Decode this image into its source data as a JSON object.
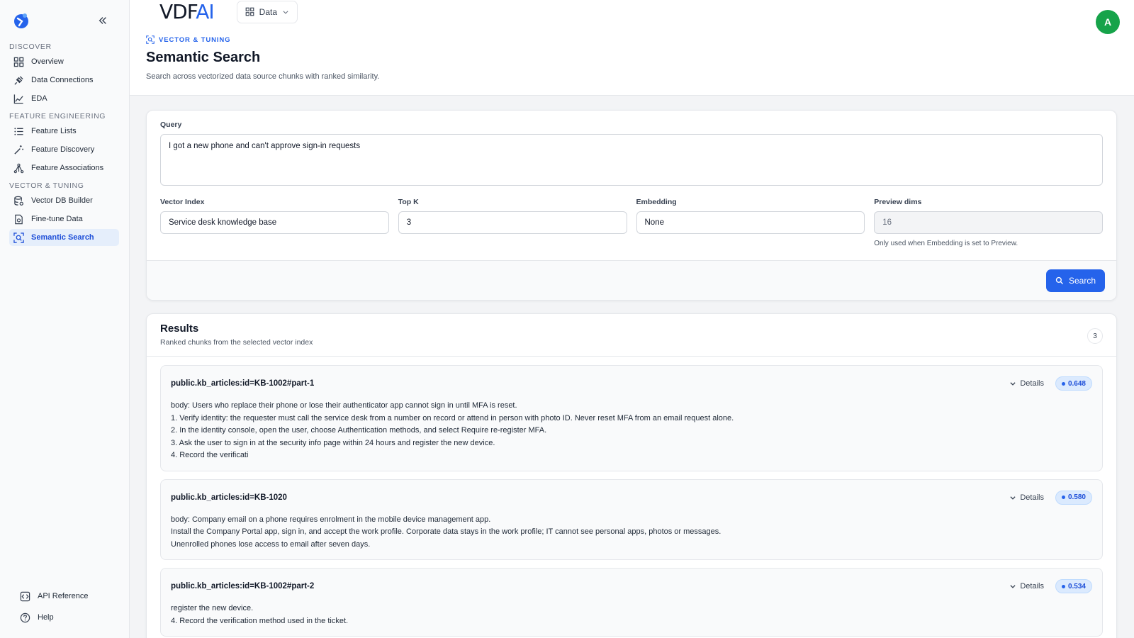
{
  "sidebar": {
    "sections": [
      {
        "title": "DISCOVER",
        "items": [
          {
            "label": "Overview",
            "icon": "grid-icon"
          },
          {
            "label": "Data Connections",
            "icon": "plug-icon"
          },
          {
            "label": "EDA",
            "icon": "chart-icon"
          }
        ]
      },
      {
        "title": "FEATURE ENGINEERING",
        "items": [
          {
            "label": "Feature Lists",
            "icon": "list-icon"
          },
          {
            "label": "Feature Discovery",
            "icon": "wand-icon"
          },
          {
            "label": "Feature Associations",
            "icon": "network-icon"
          }
        ]
      },
      {
        "title": "VECTOR & TUNING",
        "items": [
          {
            "label": "Vector DB Builder",
            "icon": "database-icon"
          },
          {
            "label": "Fine-tune Data",
            "icon": "file-icon"
          },
          {
            "label": "Semantic Search",
            "icon": "search-scan-icon",
            "active": true
          }
        ]
      }
    ],
    "bottom": [
      {
        "label": "API Reference",
        "icon": "code-icon"
      },
      {
        "label": "Help",
        "icon": "help-icon"
      }
    ]
  },
  "topbar": {
    "brand_main": "VDF",
    "brand_accent": "AI",
    "data_select": "Data",
    "avatar": "A"
  },
  "header": {
    "eyebrow": "VECTOR & TUNING",
    "title": "Semantic Search",
    "subtitle": "Search across vectorized data source chunks with ranked similarity."
  },
  "query": {
    "label": "Query",
    "value": "I got a new phone and can't approve sign-in requests",
    "fields": [
      {
        "label": "Vector Index",
        "value": "Service desk knowledge base"
      },
      {
        "label": "Top K",
        "value": "3"
      },
      {
        "label": "Embedding",
        "value": "None"
      },
      {
        "label": "Preview dims",
        "value": "16",
        "help": "Only used when Embedding is set to Preview."
      }
    ],
    "search_label": "Search"
  },
  "results": {
    "title": "Results",
    "subtitle": "Ranked chunks from the selected vector index",
    "count": "3",
    "details_label": "Details",
    "items": [
      {
        "id": "public.kb_articles:id=KB-1002#part-1",
        "score": "0.648",
        "lines": [
          "body: Users who replace their phone or lose their authenticator app cannot sign in until MFA is reset.",
          "1. Verify identity: the requester must call the service desk from a number on record or attend in person with photo ID. Never reset MFA from an email request alone.",
          "2. In the identity console, open the user, choose Authentication methods, and select Require re-register MFA.",
          "3. Ask the user to sign in at the security info page within 24 hours and register the new device.",
          "4. Record the verificati"
        ]
      },
      {
        "id": "public.kb_articles:id=KB-1020",
        "score": "0.580",
        "lines": [
          "body: Company email on a phone requires enrolment in the mobile device management app.",
          "Install the Company Portal app, sign in, and accept the work profile. Corporate data stays in the work profile; IT cannot see personal apps, photos or messages.",
          "Unenrolled phones lose access to email after seven days."
        ]
      },
      {
        "id": "public.kb_articles:id=KB-1002#part-2",
        "score": "0.534",
        "lines": [
          "register the new device.",
          "4. Record the verification method used in the ticket."
        ]
      }
    ]
  }
}
